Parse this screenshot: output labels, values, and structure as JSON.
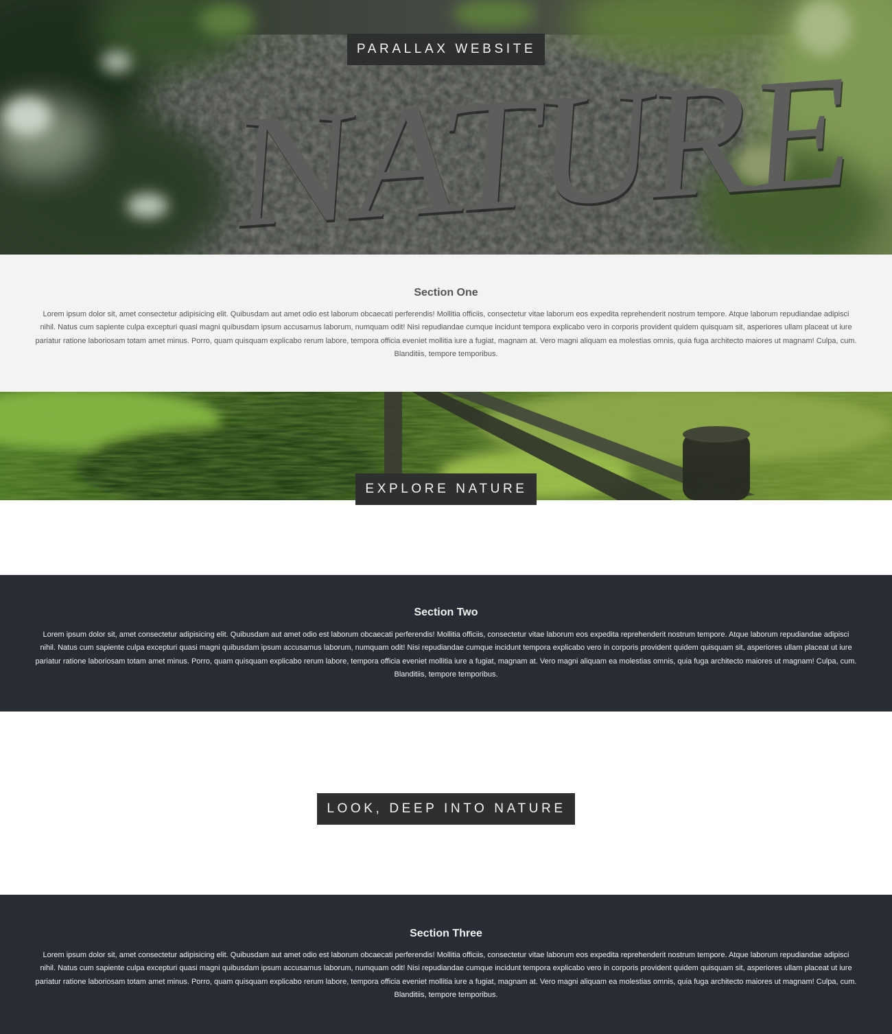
{
  "banners": {
    "one": "PARALLAX WEBSITE",
    "two": "EXPLORE NATURE",
    "three": "LOOK, DEEP INTO NATURE"
  },
  "hero_sign_text": "NATURE",
  "sections": {
    "one": {
      "title": "Section One",
      "body": "Lorem ipsum dolor sit, amet consectetur adipisicing elit. Quibusdam aut amet odio est laborum obcaecati perferendis! Mollitia officiis, consectetur vitae laborum eos expedita reprehenderit nostrum tempore. Atque laborum repudiandae adipisci nihil. Natus cum sapiente culpa excepturi quasi magni quibusdam ipsum accusamus laborum, numquam odit! Nisi repudiandae cumque incidunt tempora explicabo vero in corporis provident quidem quisquam sit, asperiores ullam placeat ut iure pariatur ratione laboriosam totam amet minus. Porro, quam quisquam explicabo rerum labore, tempora officia eveniet mollitia iure a fugiat, magnam at. Vero magni aliquam ea molestias omnis, quia fuga architecto maiores ut magnam! Culpa, cum. Blanditiis, tempore temporibus."
    },
    "two": {
      "title": "Section Two",
      "body": "Lorem ipsum dolor sit, amet consectetur adipisicing elit. Quibusdam aut amet odio est laborum obcaecati perferendis! Mollitia officiis, consectetur vitae laborum eos expedita reprehenderit nostrum tempore. Atque laborum repudiandae adipisci nihil. Natus cum sapiente culpa excepturi quasi magni quibusdam ipsum accusamus laborum, numquam odit! Nisi repudiandae cumque incidunt tempora explicabo vero in corporis provident quidem quisquam sit, asperiores ullam placeat ut iure pariatur ratione laboriosam totam amet minus. Porro, quam quisquam explicabo rerum labore, tempora officia eveniet mollitia iure a fugiat, magnam at. Vero magni aliquam ea molestias omnis, quia fuga architecto maiores ut magnam! Culpa, cum. Blanditiis, tempore temporibus."
    },
    "three": {
      "title": "Section Three",
      "body": "Lorem ipsum dolor sit, amet consectetur adipisicing elit. Quibusdam aut amet odio est laborum obcaecati perferendis! Mollitia officiis, consectetur vitae laborum eos expedita reprehenderit nostrum tempore. Atque laborum repudiandae adipisci nihil. Natus cum sapiente culpa excepturi quasi magni quibusdam ipsum accusamus laborum, numquam odit! Nisi repudiandae cumque incidunt tempora explicabo vero in corporis provident quidem quisquam sit, asperiores ullam placeat ut iure pariatur ratione laboriosam totam amet minus. Porro, quam quisquam explicabo rerum labore, tempora officia eveniet mollitia iure a fugiat, magnam at. Vero magni aliquam ea molestias omnis, quia fuga architecto maiores ut magnam! Culpa, cum. Blanditiis, tempore temporibus."
    }
  },
  "colors": {
    "caption_bg": "#2d302f",
    "caption_text": "#f4f4f4",
    "section_light_bg": "#f3f3f3",
    "section_dark_bg": "#282c34"
  }
}
